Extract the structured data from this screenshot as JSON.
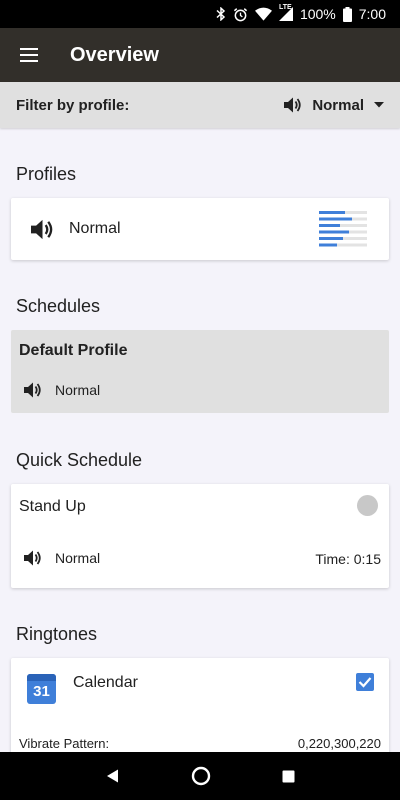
{
  "status_bar": {
    "network": "LTE",
    "battery": "100%",
    "time": "7:00"
  },
  "app_bar": {
    "title": "Overview",
    "menu_icon": "menu-icon"
  },
  "filter": {
    "label": "Filter by profile:",
    "value": "Normal"
  },
  "profiles": {
    "title": "Profiles",
    "items": [
      {
        "name": "Normal",
        "icon": "volume-icon"
      }
    ]
  },
  "schedules": {
    "title": "Schedules",
    "items": [
      {
        "name": "Default Profile",
        "profile": "Normal"
      }
    ]
  },
  "quick_schedule": {
    "title": "Quick Schedule",
    "name": "Stand Up",
    "profile": "Normal",
    "time": "Time: 0:15"
  },
  "ringtones": {
    "title": "Ringtones",
    "items": [
      {
        "name": "Calendar",
        "calendar_day": "31",
        "checked": true,
        "vibrate_label": "Vibrate Pattern:",
        "vibrate_value": "0,220,300,220"
      }
    ]
  },
  "colors": {
    "app_bar": "#322f2a",
    "accent": "#3f7fd9",
    "background": "#f4f3fa",
    "selected_card": "#e0e0e0"
  }
}
